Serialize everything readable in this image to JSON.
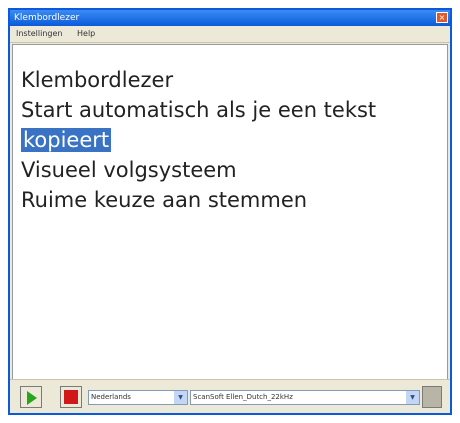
{
  "window": {
    "title": "Klembordlezer",
    "close_symbol": "×"
  },
  "menu": {
    "items": [
      "Instellingen",
      "Help"
    ]
  },
  "content": {
    "lines": [
      "Klembordlezer",
      "Start automatisch als je een tekst",
      "kopieert",
      "Visueel volgsysteem",
      "Ruime keuze aan stemmen"
    ],
    "selected_line_index": 2
  },
  "bottombar": {
    "language_select": {
      "value": "Nederlands",
      "arrow": "▼"
    },
    "voice_select": {
      "value": "ScanSoft Ellen_Dutch_22kHz",
      "arrow": "▼"
    }
  },
  "icons": [
    "play-icon",
    "stop-icon"
  ],
  "colors": {
    "titlebar": "#0a5ad9",
    "selection": "#3a73c4",
    "play": "#27a51c",
    "stop": "#d01818"
  }
}
